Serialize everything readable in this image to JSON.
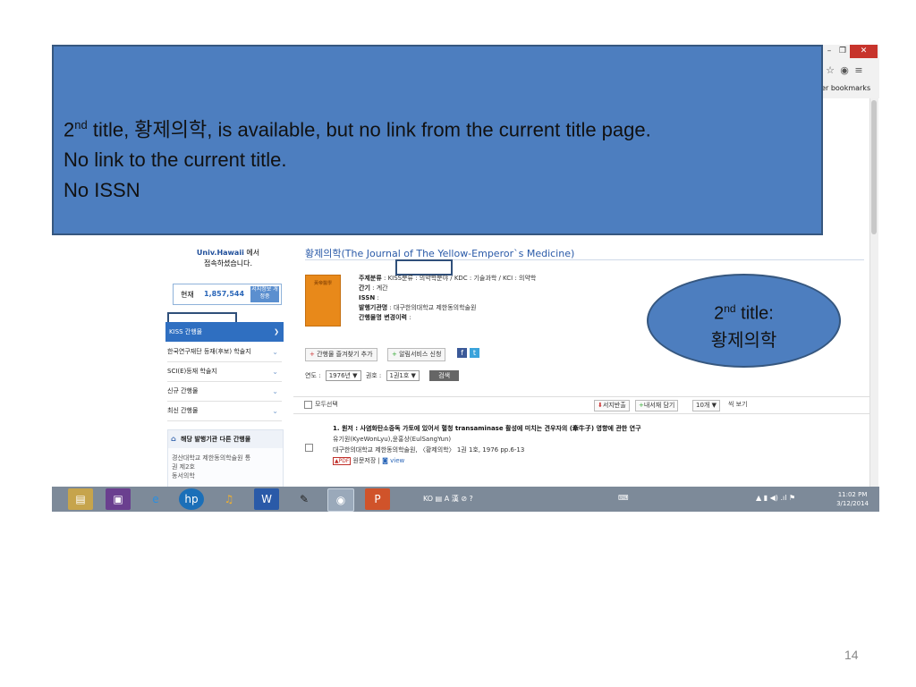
{
  "callout": {
    "line1_num": "2",
    "line1_sup": "nd",
    "line1_rest": " title, 황제의학, is available, but no link from the current title page.",
    "line2": "No link to the current title.",
    "line3": "No ISSN"
  },
  "ellipse": {
    "num": "2",
    "sup": "nd",
    "rest": " title:",
    "title": "황제의학"
  },
  "page_number": "14",
  "browser": {
    "bookmarks": "her bookmarks",
    "win_min": "–",
    "win_max": "❐",
    "win_close": "✕"
  },
  "sidebar": {
    "univ_name": "Univ.Hawaii",
    "univ_suffix": " 에서",
    "univ_line2": "접속하셨습니다.",
    "counter_label": "현재",
    "counter_value": "1,857,544",
    "counter_btn": "서지정보 개정중",
    "kiss_label": "KISS 간행물",
    "items": [
      {
        "label": "한국연구재단 등재(후보) 학술지"
      },
      {
        "label": "SCI(E)등재 학술지"
      },
      {
        "label": "신규 간행물"
      },
      {
        "label": "최신 간행물"
      }
    ],
    "pub_head": "해당 발행기관 다른 간행물",
    "pub_body_1": "경산대학교 제한동의학술원 통",
    "pub_body_2": "권 제2호",
    "pub_body_3": "동서의학"
  },
  "journal": {
    "title": "황제의학(The Journal of The Yellow-Emperor`s Medicine)",
    "cover_text": "黃帝醫學",
    "meta": [
      {
        "label": "주제분류",
        "value": "KISS분류 : 의약학분야 / KDC : 기술과학 / KCI : 의약학"
      },
      {
        "label": "간기",
        "value": "계간"
      },
      {
        "label": "ISSN",
        "value": ""
      },
      {
        "label": "발행기관명",
        "value": "대구한의대학교 제한동의학술원"
      },
      {
        "label": "간행물명 변경이력",
        "value": ""
      }
    ],
    "fav_btn": "간행물 즐겨찾기 추가",
    "alert_btn": "알림서비스 신청",
    "year_label": "연도 :",
    "year_value": "1976년 ▼",
    "vol_label": "권호 :",
    "vol_value": "1권1호 ▼",
    "search_btn": "검색",
    "select_all": "모두선택",
    "export_btn": "서지반출",
    "save_btn": "내서재 담기",
    "per_page": "10개 ▼",
    "per_page_suffix": "씩 보기"
  },
  "result": {
    "title": "1. 원저 : 사염화탄소중독 가토에 있어서 혈청 transaminase 활성에 미치는 견우자의 (牽牛子) 영향에 관한 연구",
    "authors": "유기원(KyeWonLyu),윤홍상(EulSangYun)",
    "source": "대구한의대학교 제한동의학술원, 〈황제의학〉 1권 1호, 1976 pp.6-13",
    "pdf": "▲PDF",
    "save": "원문저장",
    "view": "view"
  },
  "taskbar": {
    "lang": "KO",
    "sys_glyphs": "▤ A 漢 ⊘ ?",
    "time": "11:02 PM",
    "date": "3/12/2014"
  }
}
